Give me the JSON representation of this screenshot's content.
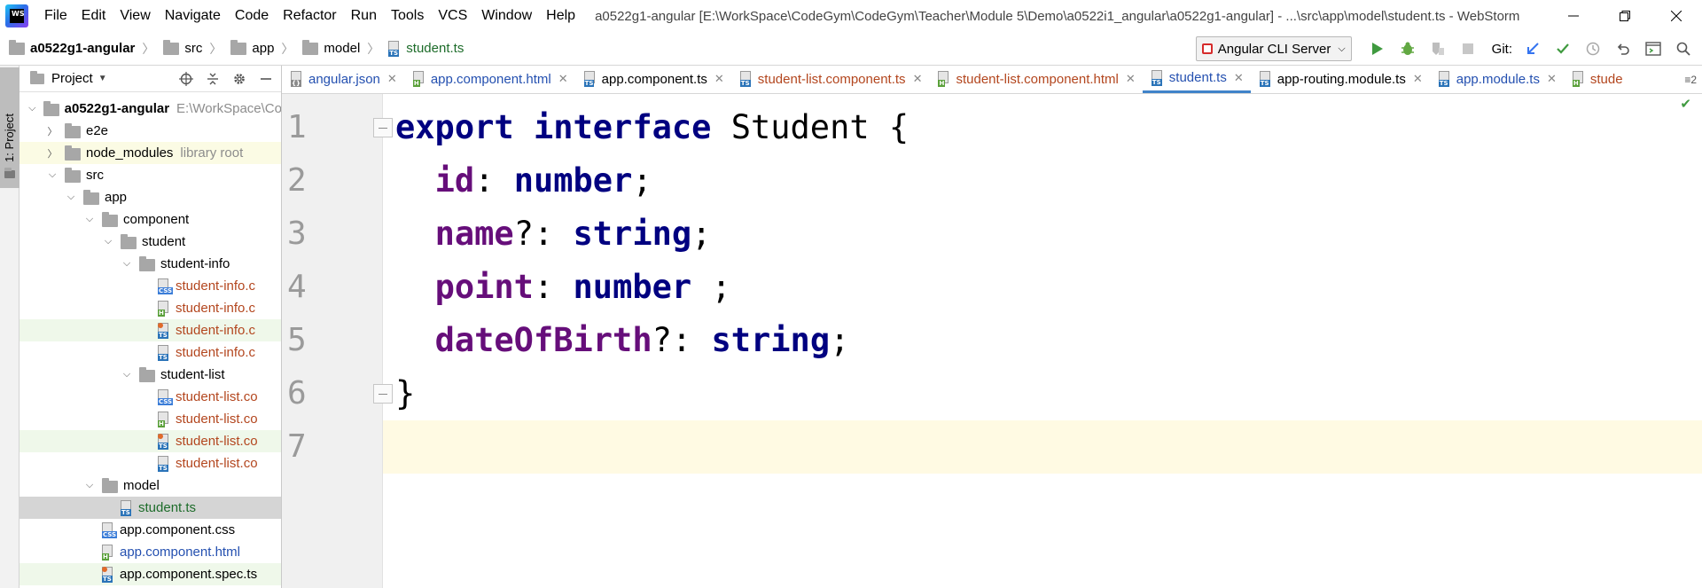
{
  "window": {
    "title": "a0522g1-angular [E:\\WorkSpace\\CodeGym\\CodeGym\\Teacher\\Module 5\\Demo\\a0522i1_angular\\a0522g1-angular] - ...\\src\\app\\model\\student.ts - WebStorm",
    "logo_text": "WS"
  },
  "menu": [
    "File",
    "Edit",
    "View",
    "Navigate",
    "Code",
    "Refactor",
    "Run",
    "Tools",
    "VCS",
    "Window",
    "Help"
  ],
  "breadcrumb": [
    "a0522g1-angular",
    "src",
    "app",
    "model",
    "student.ts"
  ],
  "toolbar": {
    "run_config": "Angular CLI Server",
    "git_label": "Git:"
  },
  "side_stripe": {
    "project_tab": "1: Project"
  },
  "project_panel": {
    "title": "Project",
    "tree": [
      {
        "label": "a0522g1-angular",
        "extra": "E:\\WorkSpace\\Co",
        "depth": 0,
        "kind": "folder",
        "expanded": true,
        "style": "bold"
      },
      {
        "label": "e2e",
        "depth": 1,
        "kind": "folder",
        "expanded": false
      },
      {
        "label": "node_modules",
        "extra": "library root",
        "depth": 1,
        "kind": "folder",
        "expanded": false,
        "highlight": "yellow"
      },
      {
        "label": "src",
        "depth": 1,
        "kind": "folder",
        "expanded": true
      },
      {
        "label": "app",
        "depth": 2,
        "kind": "folder",
        "expanded": true
      },
      {
        "label": "component",
        "depth": 3,
        "kind": "folder",
        "expanded": true
      },
      {
        "label": "student",
        "depth": 4,
        "kind": "folder",
        "expanded": true
      },
      {
        "label": "student-info",
        "depth": 5,
        "kind": "folder",
        "expanded": true
      },
      {
        "label": "student-info.c",
        "depth": 6,
        "kind": "css",
        "style": "red"
      },
      {
        "label": "student-info.c",
        "depth": 6,
        "kind": "html",
        "style": "red"
      },
      {
        "label": "student-info.c",
        "depth": 6,
        "kind": "spec",
        "style": "red",
        "highlight": "green"
      },
      {
        "label": "student-info.c",
        "depth": 6,
        "kind": "ts",
        "style": "red"
      },
      {
        "label": "student-list",
        "depth": 5,
        "kind": "folder",
        "expanded": true
      },
      {
        "label": "student-list.co",
        "depth": 6,
        "kind": "css",
        "style": "red"
      },
      {
        "label": "student-list.co",
        "depth": 6,
        "kind": "html",
        "style": "red"
      },
      {
        "label": "student-list.co",
        "depth": 6,
        "kind": "spec",
        "style": "red",
        "highlight": "green"
      },
      {
        "label": "student-list.co",
        "depth": 6,
        "kind": "ts",
        "style": "red"
      },
      {
        "label": "model",
        "depth": 3,
        "kind": "folder",
        "expanded": true
      },
      {
        "label": "student.ts",
        "depth": 4,
        "kind": "ts",
        "style": "green",
        "selected": true
      },
      {
        "label": "app.component.css",
        "depth": 3,
        "kind": "css",
        "style": "plain"
      },
      {
        "label": "app.component.html",
        "depth": 3,
        "kind": "html",
        "style": "blue"
      },
      {
        "label": "app.component.spec.ts",
        "depth": 3,
        "kind": "spec",
        "style": "plain",
        "highlight": "green"
      }
    ]
  },
  "tabs": [
    {
      "label": "angular.json",
      "kind": "json",
      "style": "blue"
    },
    {
      "label": "app.component.html",
      "kind": "html",
      "style": "blue"
    },
    {
      "label": "app.component.ts",
      "kind": "ts",
      "style": "black"
    },
    {
      "label": "student-list.component.ts",
      "kind": "ts",
      "style": "red"
    },
    {
      "label": "student-list.component.html",
      "kind": "html",
      "style": "red"
    },
    {
      "label": "student.ts",
      "kind": "ts",
      "style": "blue",
      "active": true
    },
    {
      "label": "app-routing.module.ts",
      "kind": "ts",
      "style": "black"
    },
    {
      "label": "app.module.ts",
      "kind": "ts",
      "style": "blue"
    },
    {
      "label": "stude",
      "kind": "html",
      "style": "red",
      "partial": true
    }
  ],
  "tabs_overflow": "≡2",
  "editor": {
    "current_line": 7,
    "lines": [
      {
        "n": "1",
        "tokens": [
          {
            "t": "export ",
            "c": "kw"
          },
          {
            "t": "interface ",
            "c": "kw"
          },
          {
            "t": "Student {",
            "c": ""
          }
        ]
      },
      {
        "n": "2",
        "tokens": [
          {
            "t": "  ",
            "c": ""
          },
          {
            "t": "id",
            "c": "prop"
          },
          {
            "t": ": ",
            "c": ""
          },
          {
            "t": "number",
            "c": "kw"
          },
          {
            "t": ";",
            "c": ""
          }
        ]
      },
      {
        "n": "3",
        "tokens": [
          {
            "t": "  ",
            "c": ""
          },
          {
            "t": "name",
            "c": "prop"
          },
          {
            "t": "?: ",
            "c": ""
          },
          {
            "t": "string",
            "c": "kw"
          },
          {
            "t": ";",
            "c": ""
          }
        ]
      },
      {
        "n": "4",
        "tokens": [
          {
            "t": "  ",
            "c": ""
          },
          {
            "t": "point",
            "c": "prop"
          },
          {
            "t": ": ",
            "c": ""
          },
          {
            "t": "number",
            "c": "kw"
          },
          {
            "t": " ;",
            "c": ""
          }
        ]
      },
      {
        "n": "5",
        "tokens": [
          {
            "t": "  ",
            "c": ""
          },
          {
            "t": "dateOfBirth",
            "c": "prop"
          },
          {
            "t": "?: ",
            "c": ""
          },
          {
            "t": "string",
            "c": "kw"
          },
          {
            "t": ";",
            "c": ""
          }
        ]
      },
      {
        "n": "6",
        "tokens": [
          {
            "t": "}",
            "c": ""
          }
        ]
      },
      {
        "n": "7",
        "tokens": []
      }
    ]
  },
  "colors": {
    "keyword": "#000080",
    "property": "#660e7a",
    "current_line": "#fffae3",
    "active_tab": "#4083c9",
    "vcs_added": "#1d6c2a",
    "vcs_unversioned": "#b3461e",
    "vcs_modified": "#2450b0"
  }
}
